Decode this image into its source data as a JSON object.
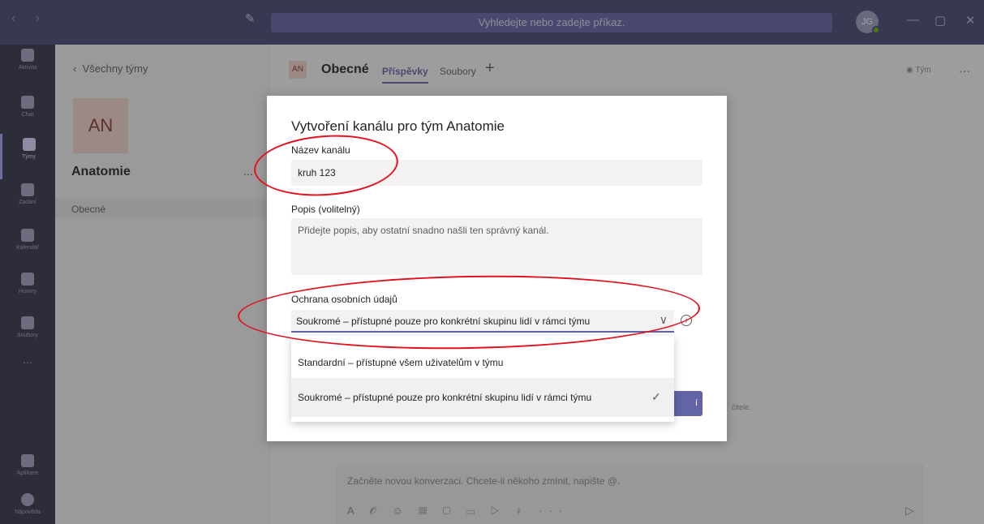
{
  "titlebar": {
    "nav_arrows": "‹ ›",
    "search_placeholder": "Vyhledejte nebo zadejte příkaz.",
    "avatar_initials": "JG"
  },
  "rail": [
    {
      "label": "Aktivita",
      "icon": "bell-icon"
    },
    {
      "label": "Chat",
      "icon": "chat-icon"
    },
    {
      "label": "Týmy",
      "icon": "teams-icon",
      "active": true
    },
    {
      "label": "Zadání",
      "icon": "assignments-icon"
    },
    {
      "label": "Kalendář",
      "icon": "calendar-icon"
    },
    {
      "label": "Hovory",
      "icon": "phone-icon"
    },
    {
      "label": "Soubory",
      "icon": "files-icon"
    },
    {
      "label": "...",
      "icon": "more-icon"
    },
    {
      "label": "Aplikace",
      "icon": "apps-icon"
    },
    {
      "label": "Nápověda",
      "icon": "help-icon"
    }
  ],
  "team_panel": {
    "back_label": "Všechny týmy",
    "team_initials": "AN",
    "team_name": "Anatomie",
    "more": "...",
    "channel": "Obecné"
  },
  "header": {
    "channel_initials": "AN",
    "channel_name": "Obecné",
    "tabs": [
      "Příspěvky",
      "Soubory"
    ],
    "add_tab": "+",
    "team_button": "Tým",
    "more": "···"
  },
  "compose": {
    "placeholder": "Začněte novou konverzaci. Chcete-li někoho zmínit, napište @.",
    "tools": "A 𝒪 ☺ ▦ ▢ ▭ ▷ ♀ ···",
    "side_text": "čitele."
  },
  "dialog": {
    "title": "Vytvoření kanálu pro tým Anatomie",
    "name_label": "Název kanálu",
    "name_value": "kruh 123",
    "desc_label": "Popis (volitelný)",
    "desc_placeholder": "Přidejte popis, aby ostatní snadno našli ten správný kanál.",
    "privacy_label": "Ochrana osobních údajů",
    "privacy_value": "Soukromé – přístupné pouze pro konkrétní skupinu lidí v rámci týmu",
    "create_partial": "í",
    "options": [
      {
        "label": "Standardní – přístupné všem uživatelům v týmu",
        "selected": false
      },
      {
        "label": "Soukromé – přístupné pouze pro konkrétní skupinu lidí v rámci týmu",
        "selected": true
      }
    ]
  },
  "colors": {
    "accent": "#6264a7",
    "titlebar": "#464775",
    "rail": "#33344a",
    "annotation": "#e3101d"
  }
}
